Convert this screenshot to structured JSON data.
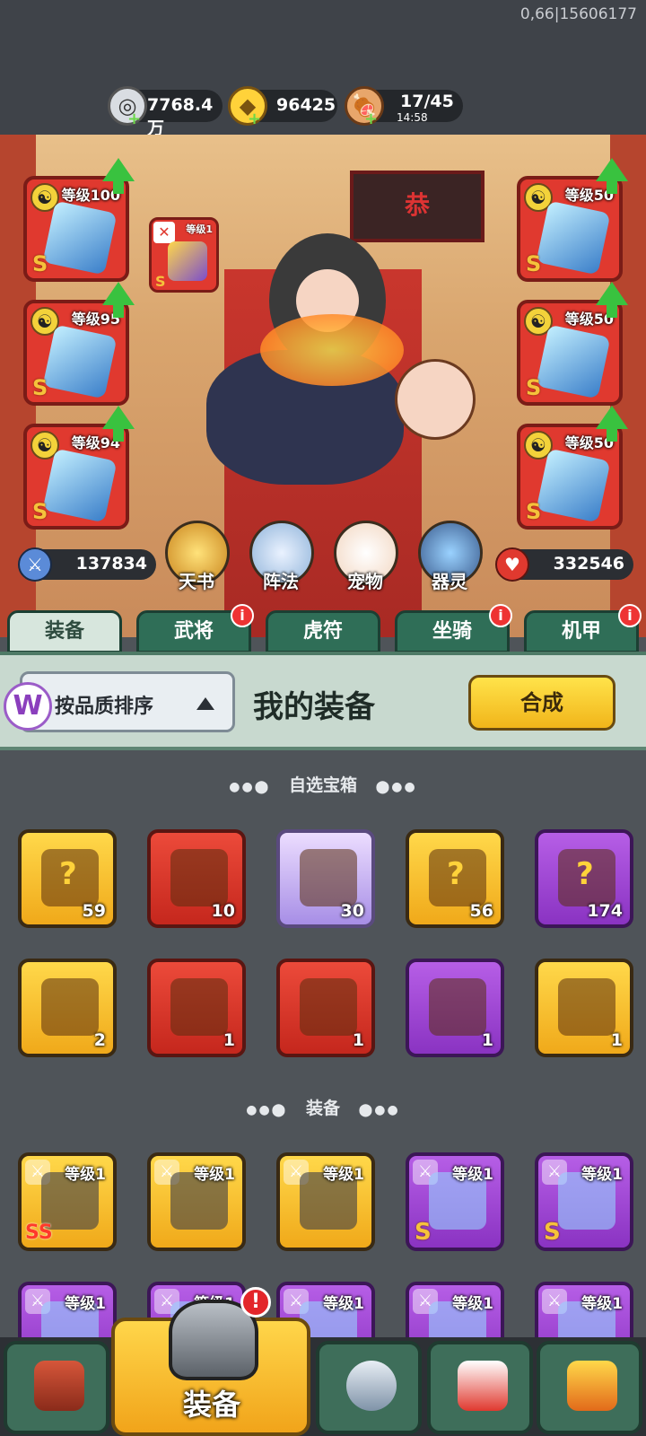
{
  "status": {
    "debug": "0,66|15606177"
  },
  "resources": {
    "silver": "7768.4万",
    "gold": "96425",
    "stamina": "17/45",
    "stamina_timer": "14:58"
  },
  "equipped": {
    "left": [
      {
        "level": "等级100",
        "grade": "S"
      },
      {
        "level": "等级95",
        "grade": "S"
      },
      {
        "level": "等级94",
        "grade": "S"
      }
    ],
    "right": [
      {
        "level": "等级50",
        "grade": "S"
      },
      {
        "level": "等级50",
        "grade": "S"
      },
      {
        "level": "等级50",
        "grade": "S"
      }
    ],
    "small_slot": {
      "level": "等级1",
      "grade": "S"
    }
  },
  "hero_banner": {
    "text": "恭"
  },
  "stats": {
    "attack": "137834",
    "hp": "332546"
  },
  "features": [
    "天书",
    "阵法",
    "宠物",
    "器灵"
  ],
  "tabs": [
    {
      "label": "装备",
      "badge": ""
    },
    {
      "label": "武将",
      "badge": "i"
    },
    {
      "label": "虎符",
      "badge": ""
    },
    {
      "label": "坐骑",
      "badge": "i"
    },
    {
      "label": "机甲",
      "badge": "i"
    }
  ],
  "panel": {
    "sort_label": "按品质排序",
    "title": "我的装备",
    "merge_label": "合成",
    "logo": "W"
  },
  "sections": {
    "chests": "自选宝箱",
    "equipment": "装备"
  },
  "chests": [
    {
      "count": "59",
      "color": "gold"
    },
    {
      "count": "10",
      "color": "red"
    },
    {
      "count": "30",
      "color": "lilac"
    },
    {
      "count": "56",
      "color": "gold"
    },
    {
      "count": "174",
      "color": "purple"
    },
    {
      "count": "2",
      "color": "gold"
    },
    {
      "count": "1",
      "color": "red"
    },
    {
      "count": "1",
      "color": "red"
    },
    {
      "count": "1",
      "color": "purple"
    },
    {
      "count": "1",
      "color": "gold"
    }
  ],
  "equipment_items": [
    {
      "level": "等级1",
      "grade": "SS",
      "color": "gold"
    },
    {
      "level": "等级1",
      "grade": "",
      "color": "gold"
    },
    {
      "level": "等级1",
      "grade": "",
      "color": "gold"
    },
    {
      "level": "等级1",
      "grade": "S",
      "color": "purple"
    },
    {
      "level": "等级1",
      "grade": "S",
      "color": "purple"
    },
    {
      "level": "等级1",
      "grade": "",
      "color": "purple"
    },
    {
      "level": "等级1",
      "grade": "",
      "color": "purple"
    },
    {
      "level": "等级1",
      "grade": "",
      "color": "purple"
    },
    {
      "level": "等级1",
      "grade": "",
      "color": "purple"
    },
    {
      "level": "等级1",
      "grade": "",
      "color": "purple"
    }
  ],
  "bottom_nav": {
    "active_label": "装备",
    "alert": "!"
  },
  "colors": {
    "accent_green": "#39c23f",
    "gold": "#f1b51a",
    "red": "#e0392f",
    "purple": "#8a33c2"
  }
}
